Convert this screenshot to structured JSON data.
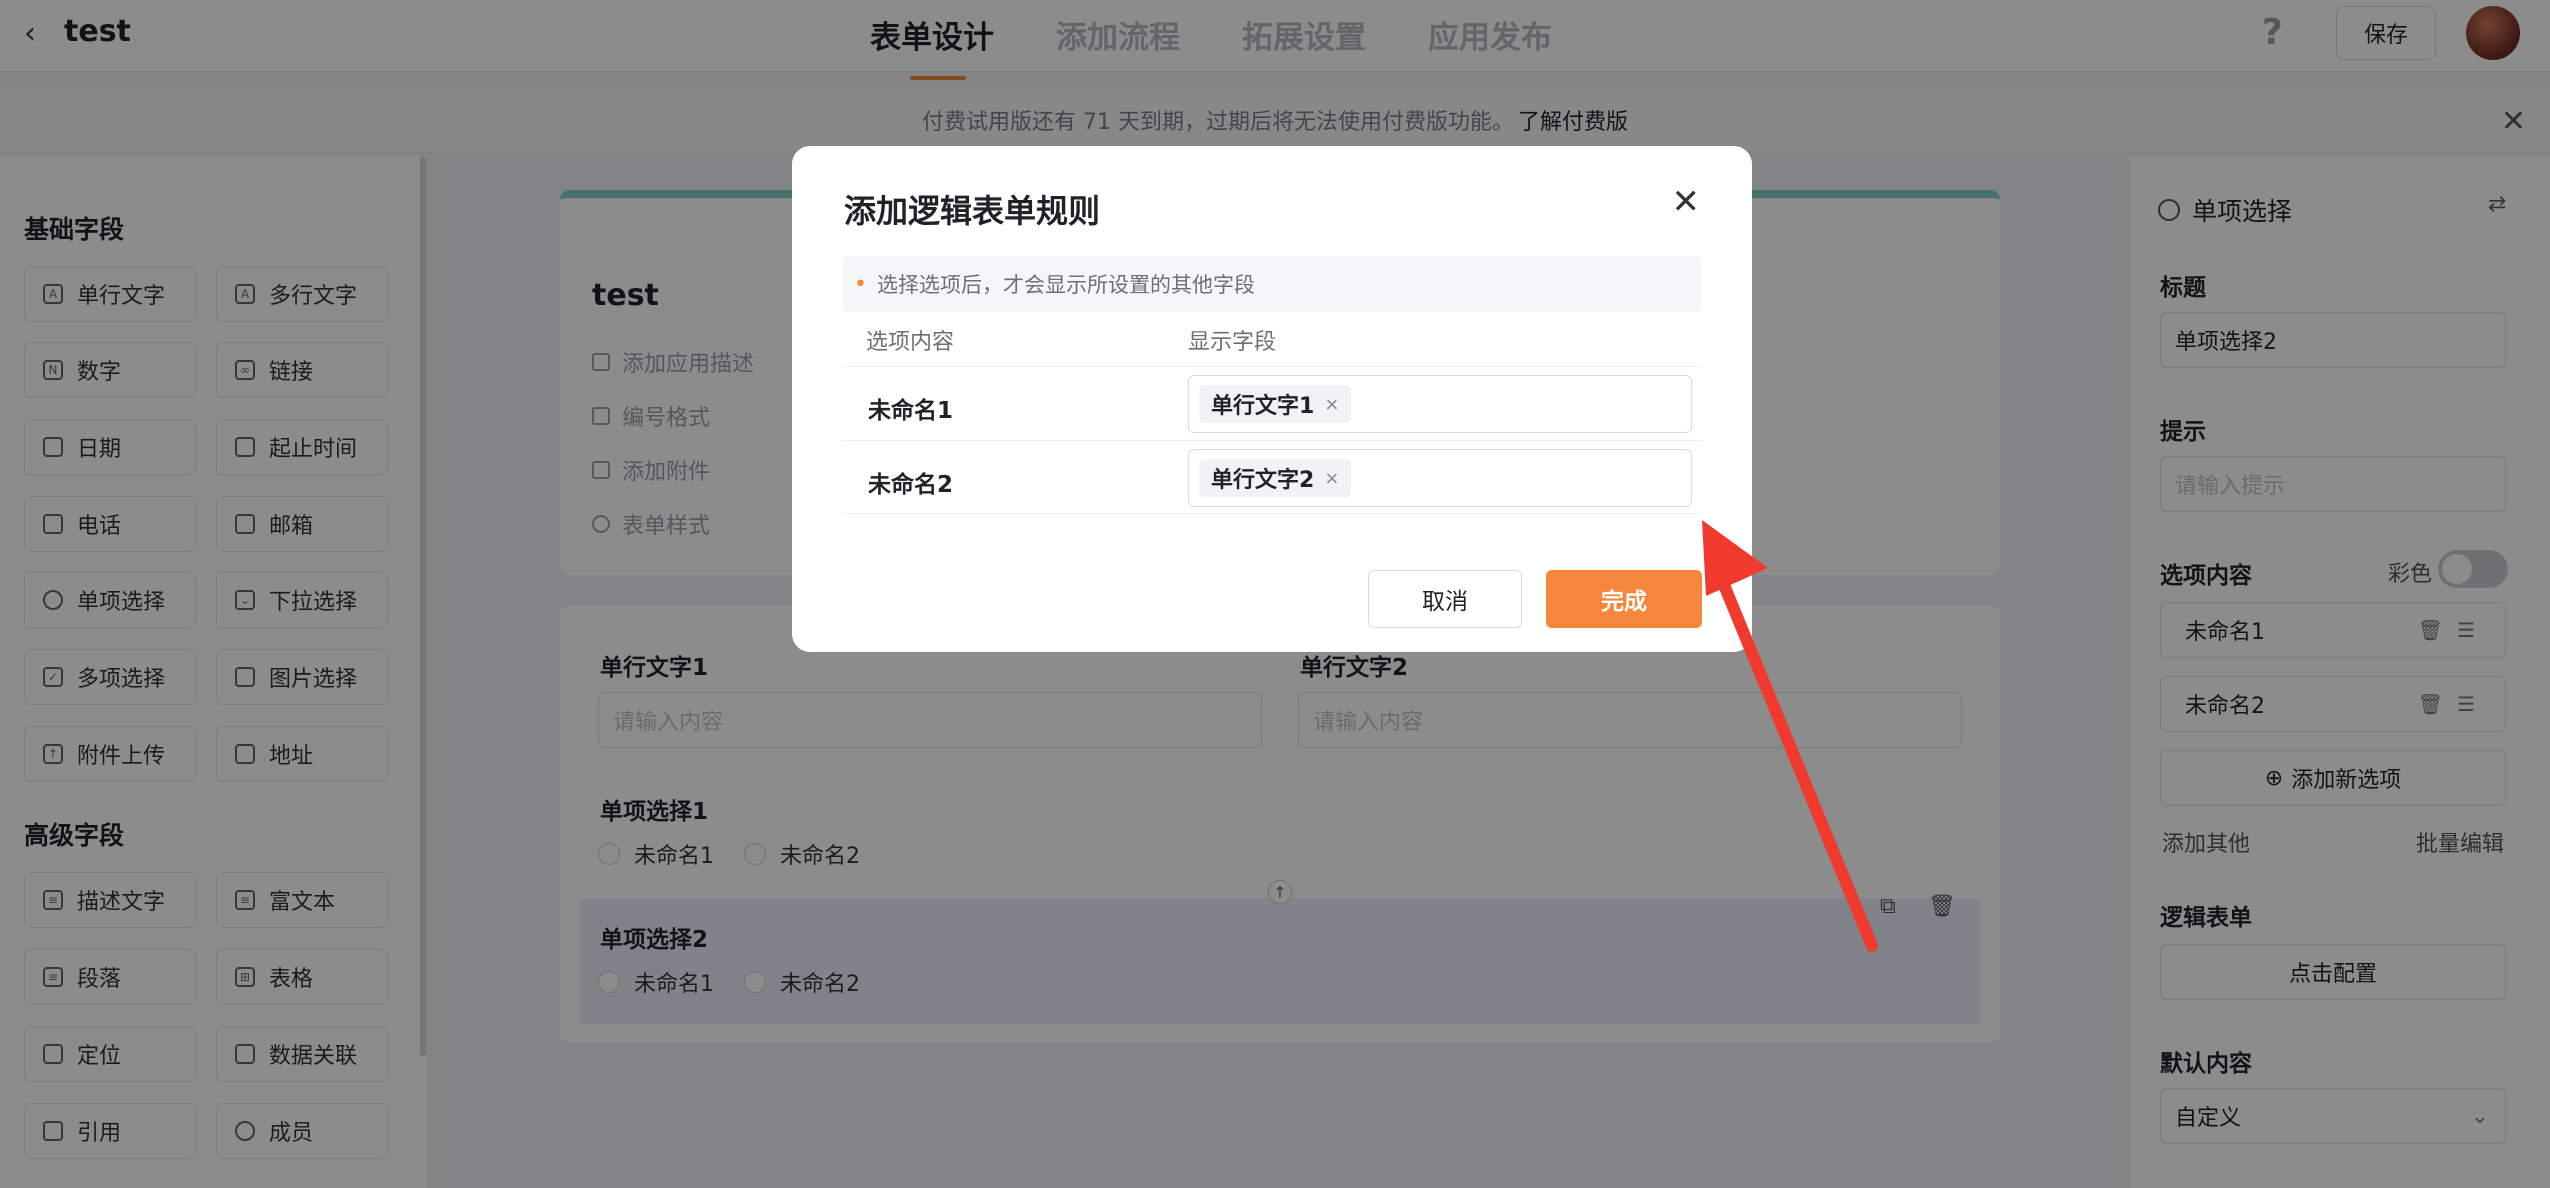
{
  "header": {
    "back_icon": "chevron-left-icon",
    "app_title": "test",
    "tabs": [
      "表单设计",
      "添加流程",
      "拓展设置",
      "应用发布"
    ],
    "active_tab": 0,
    "help_label": "?",
    "save_label": "保存"
  },
  "banner": {
    "text": "付费试用版还有 71 天到期，过期后将无法使用付费版功能。",
    "link": "了解付费版",
    "close": "✕"
  },
  "sidebar": {
    "basic_title": "基础字段",
    "basic_fields": [
      "单行文字",
      "多行文字",
      "数字",
      "链接",
      "日期",
      "起止时间",
      "电话",
      "邮箱",
      "单项选择",
      "下拉选择",
      "多项选择",
      "图片选择",
      "附件上传",
      "地址"
    ],
    "advanced_title": "高级字段",
    "advanced_fields": [
      "描述文字",
      "富文本",
      "段落",
      "表格",
      "定位",
      "数据关联",
      "引用",
      "成员"
    ]
  },
  "canvas": {
    "form_title": "test",
    "meta": [
      "添加应用描述",
      "编号格式",
      "添加附件",
      "表单样式"
    ],
    "field1_label": "单行文字1",
    "field1_placeholder": "请输入内容",
    "field2_label": "单行文字2",
    "field2_placeholder": "请输入内容",
    "radio1_label": "单项选择1",
    "radio1_options": [
      "未命名1",
      "未命名2"
    ],
    "radio2_label": "单项选择2",
    "radio2_options": [
      "未命名1",
      "未命名2"
    ]
  },
  "right_panel": {
    "field_type": "单项选择",
    "title_label": "标题",
    "title_value": "单项选择2",
    "hint_label": "提示",
    "hint_placeholder": "请输入提示",
    "options_label": "选项内容",
    "color_label": "彩色",
    "options": [
      "未命名1",
      "未命名2"
    ],
    "add_option": "添加新选项",
    "add_other": "添加其他",
    "batch_edit": "批量编辑",
    "logic_label": "逻辑表单",
    "logic_button": "点击配置",
    "default_label": "默认内容",
    "default_value": "自定义"
  },
  "modal": {
    "title": "添加逻辑表单规则",
    "close": "✕",
    "tip": "选择选项后，才会显示所设置的其他字段",
    "col_option": "选项内容",
    "col_display": "显示字段",
    "rows": [
      {
        "option": "未命名1",
        "tag": "单行文字1"
      },
      {
        "option": "未命名2",
        "tag": "单行文字2"
      }
    ],
    "tag_remove": "×",
    "cancel": "取消",
    "confirm": "完成"
  },
  "colors": {
    "accent": "#f5873c",
    "annotation_arrow": "#f03a2e"
  }
}
